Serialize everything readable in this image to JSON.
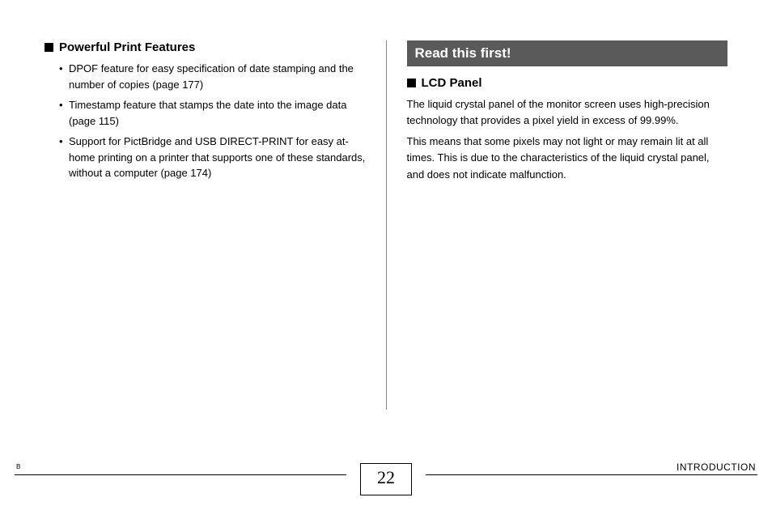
{
  "left": {
    "heading": "Powerful Print Features",
    "items": [
      "DPOF feature for easy specification of date stamping and the number of copies (page 177)",
      "Timestamp feature that stamps the date into the image data (page 115)",
      "Support for PictBridge and USB DIRECT-PRINT for easy at-home printing on a printer that supports one of these standards, without a computer (page 174)"
    ]
  },
  "right": {
    "banner": "Read this first!",
    "heading": "LCD Panel",
    "para1": "The liquid crystal panel of the monitor screen uses high-precision technology that provides a pixel yield in excess of 99.99%.",
    "para2": "This means that some pixels may not light or may remain lit at all times. This is due to the characteristics of the liquid crystal panel, and does not indicate malfunction."
  },
  "footer": {
    "left_mark": "B",
    "page_number": "22",
    "section": "INTRODUCTION"
  }
}
